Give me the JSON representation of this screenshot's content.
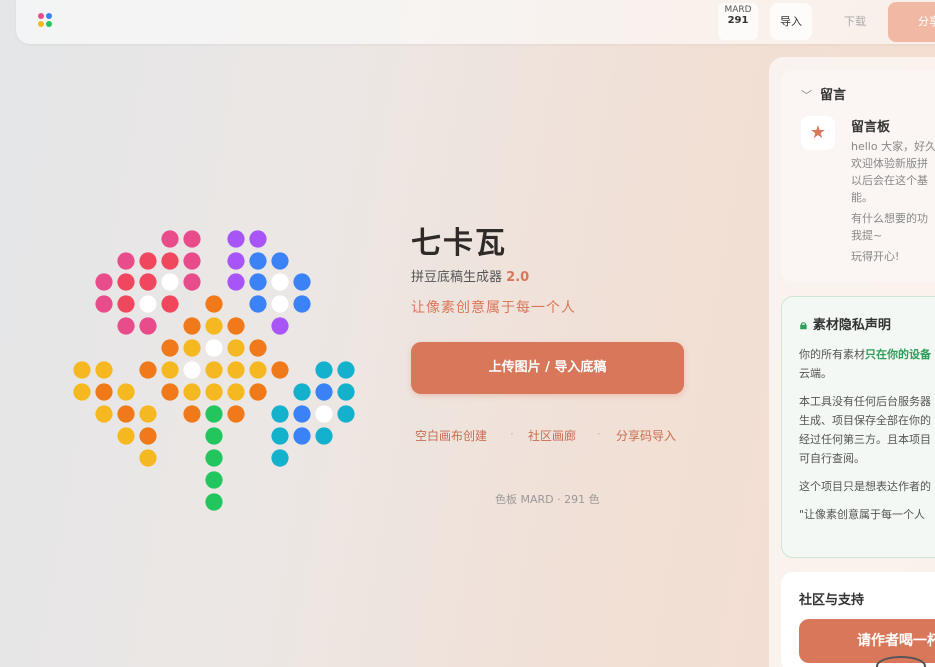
{
  "topbar": {
    "mard_label": "MARD",
    "mard_count": "291",
    "import_label": "导入",
    "download_label": "下载",
    "share_label": "分享",
    "logo_colors": [
      "#e84c8b",
      "#3b82f6",
      "#f5b820",
      "#22c55e"
    ]
  },
  "hero": {
    "title": "七卡瓦",
    "subtitle": "拼豆底稿生成器",
    "version": "2.0",
    "slogan": "让像素创意属于每一个人",
    "upload_label": "上传图片 / 导入底稿",
    "links": [
      "空白画布创建",
      "社区画廊",
      "分享码导入"
    ],
    "separator": "·",
    "palette_info": "色板 MARD · 291 色"
  },
  "colors": {
    "accent": "#d9775a",
    "pink": "#e84c8b",
    "red": "#f0475e",
    "purple": "#a855f7",
    "blue": "#3b82f6",
    "orange": "#f07a1a",
    "yellow": "#f5b820",
    "green": "#22c55e",
    "cyan": "#14b1cc",
    "white": "#ffffff",
    "privacy_green": "#2e9d59"
  },
  "messages": {
    "header": "留言",
    "board_title": "留言板",
    "lines": [
      "hello 大家，好久",
      "欢迎体验新版拼",
      "以后会在这个基",
      "能。",
      "有什么想要的功",
      "我提~",
      "玩得开心!"
    ]
  },
  "privacy": {
    "title": "素材隐私声明",
    "p1_pre": "你的所有素材",
    "p1_highlight": "只在你的设备",
    "p1_line2": "云端。",
    "p2_lines": [
      "本工具没有任何后台服务器",
      "生成、项目保存全部在你的",
      "经过任何第三方。且本项目",
      "可自行查阅。"
    ],
    "p3": "这个项目只是想表达作者的",
    "p4": "\"让像素创意属于每一个人"
  },
  "community": {
    "title": "社区与支持",
    "coffee_label": "请作者喝一杯"
  }
}
